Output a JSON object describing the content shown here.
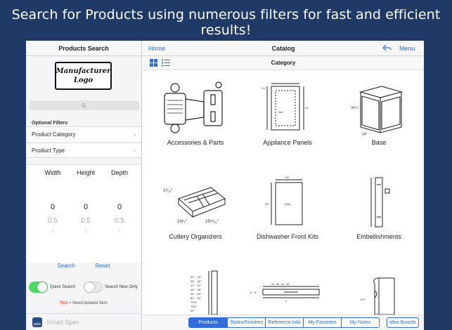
{
  "banner": "Search for Products using numerous filters for fast and efficient results!",
  "sidebar": {
    "title": "Products Search",
    "logo_line1": "Manufacturer",
    "logo_line2": "Logo",
    "optional_filters_title": "Optional Filters",
    "filters": [
      {
        "label": "Product Category"
      },
      {
        "label": "Product Type"
      }
    ],
    "dimensions": [
      {
        "label": "Width",
        "value": "0",
        "next": "0.5",
        "next2": "1"
      },
      {
        "label": "Height",
        "value": "0",
        "next": "0.5",
        "next2": "1"
      },
      {
        "label": "Depth",
        "value": "0",
        "next": "0.5",
        "next2": "1"
      }
    ],
    "search_label": "Search",
    "reset_label": "Reset",
    "quick_search_label": "Quick Search",
    "quick_search_on": true,
    "search_new_only_label": "Search New Only",
    "search_new_only_on": false,
    "legend_red": "Red",
    "legend_text": " = New/Updated Item",
    "footer_app_name": "Smart Spec",
    "footer_icon_text": "spec"
  },
  "main": {
    "home_label": "Home",
    "title": "Catalog",
    "menu_label": "Menu",
    "category_title": "Category",
    "tiles": [
      {
        "label": "Accessories & Parts"
      },
      {
        "label": "Appliance Panels"
      },
      {
        "label": "Base"
      },
      {
        "label": "Cutlery Organizers"
      },
      {
        "label": "Dishwasher Front Kits"
      },
      {
        "label": "Embellishments"
      }
    ],
    "tabs": [
      {
        "label": "Products",
        "active": true
      },
      {
        "label": "Styles/Finishes",
        "active": false
      },
      {
        "label": "Reference Info",
        "active": false
      },
      {
        "label": "My Favorites",
        "active": false
      },
      {
        "label": "My Notes",
        "active": false
      }
    ],
    "idea_boards_label": "Idea Boards"
  },
  "colors": {
    "background": "#1f3a66",
    "accent": "#2f6ddb",
    "toggle_on": "#4cd964",
    "new_item_red": "#e0301e"
  }
}
